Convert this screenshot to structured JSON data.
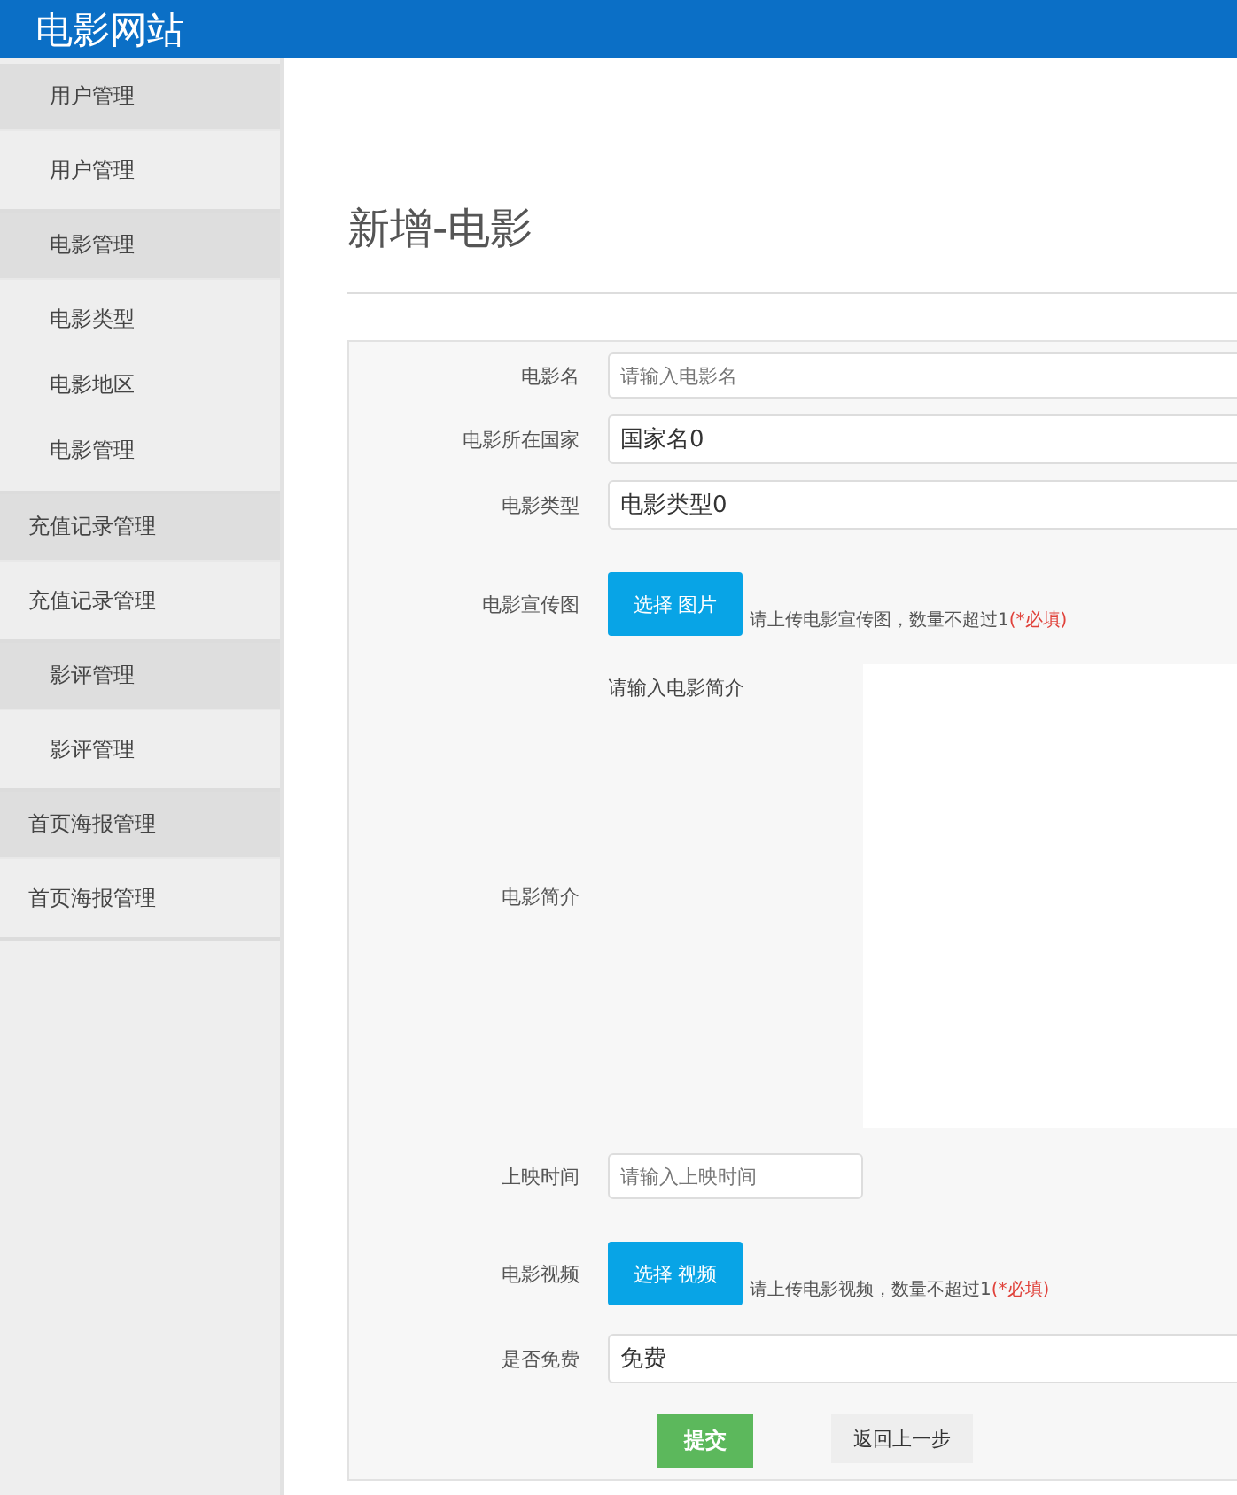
{
  "header": {
    "title": "电影网站"
  },
  "sidebar": {
    "sections": [
      {
        "title": "用户管理",
        "items": [
          {
            "label": "用户管理"
          }
        ]
      },
      {
        "title": "电影管理",
        "items": [
          {
            "label": "电影类型"
          },
          {
            "label": "电影地区"
          },
          {
            "label": "电影管理"
          }
        ]
      },
      {
        "title": "充值记录管理",
        "items": [
          {
            "label": "充值记录管理"
          }
        ]
      },
      {
        "title": "影评管理",
        "items": [
          {
            "label": "影评管理"
          }
        ]
      },
      {
        "title": "首页海报管理",
        "items": [
          {
            "label": "首页海报管理"
          }
        ]
      }
    ]
  },
  "page": {
    "title": "新增-电影"
  },
  "form": {
    "fields": [
      {
        "kind": "text",
        "label": "电影名",
        "placeholder": "请输入电影名"
      },
      {
        "kind": "select",
        "label": "电影所在国家",
        "value": "国家名0"
      },
      {
        "kind": "select",
        "label": "电影类型",
        "value": "电影类型0"
      },
      {
        "kind": "upload",
        "label": "电影宣传图",
        "button": "选择 图片",
        "hint": "请上传电影宣传图，数量不超过1",
        "required": "(*必填)"
      },
      {
        "kind": "textarea",
        "label": "电影简介",
        "placeholder": "请输入电影简介"
      },
      {
        "kind": "date",
        "label": "上映时间",
        "placeholder": "请输入上映时间"
      },
      {
        "kind": "upload",
        "label": "电影视频",
        "button": "选择 视频",
        "hint": "请上传电影视频，数量不超过1",
        "required": "(*必填)"
      },
      {
        "kind": "select",
        "label": "是否免费",
        "value": "免费"
      }
    ],
    "buttons": [
      {
        "kind": "submit",
        "label": "提交"
      },
      {
        "kind": "back",
        "label": "返回上一步"
      }
    ]
  }
}
